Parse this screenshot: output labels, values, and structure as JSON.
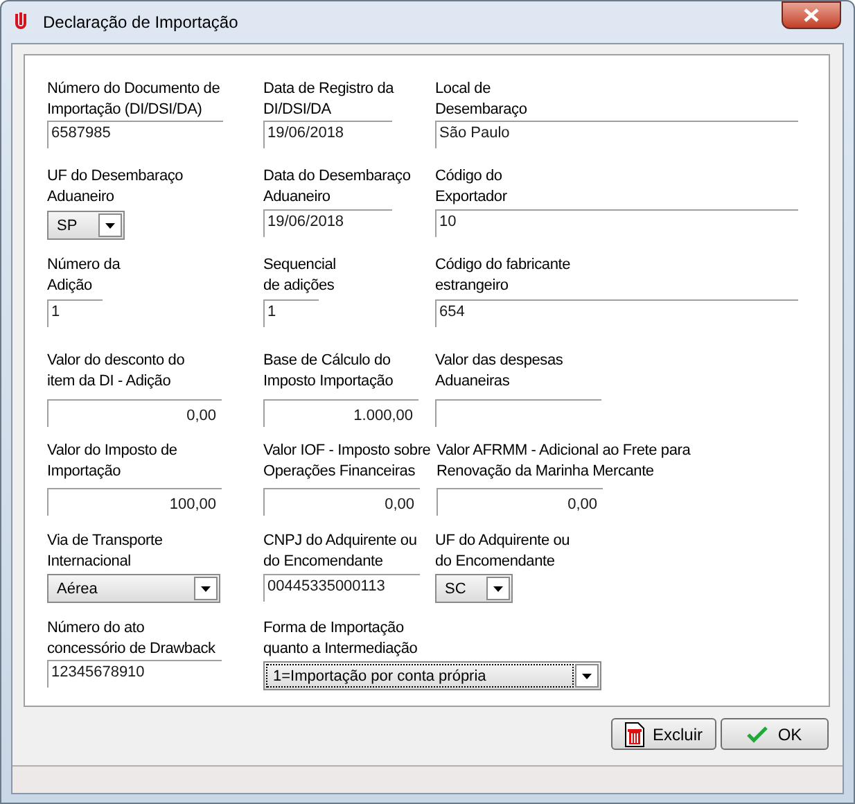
{
  "window": {
    "title": "Declaração de Importação"
  },
  "fields": [
    {
      "kind": "text",
      "label": "Número do Documento de\nImportação (DI/DSI/DA)",
      "value": "6587985"
    },
    {
      "kind": "text",
      "label": "Data de Registro da\nDI/DSI/DA",
      "value": "19/06/2018"
    },
    {
      "kind": "text",
      "label": "Local de\nDesembaraço",
      "value": "São Paulo"
    },
    {
      "kind": "combo",
      "label": "UF do Desembaraço\nAduaneiro",
      "value": "SP",
      "focused": false
    },
    {
      "kind": "text",
      "label": "Data do Desembaraço\nAduaneiro",
      "value": "19/06/2018"
    },
    {
      "kind": "text",
      "label": "Código do\nExportador",
      "value": "10"
    },
    {
      "kind": "text",
      "label": "Número da\nAdição",
      "value": "1"
    },
    {
      "kind": "text",
      "label": "Sequencial\nde adições",
      "value": "1"
    },
    {
      "kind": "text",
      "label": "Código do fabricante\nestrangeiro",
      "value": "654"
    },
    {
      "kind": "number",
      "label": "Valor do desconto do\nitem da DI - Adição",
      "value": "0,00"
    },
    {
      "kind": "number",
      "label": "Base de Cálculo do\nImposto Importação",
      "value": "1.000,00"
    },
    {
      "kind": "number",
      "label": "Valor das despesas\nAduaneiras"
    },
    {
      "kind": "number",
      "label": "Valor do Imposto de\nImportação",
      "value": "100,00"
    },
    {
      "kind": "number",
      "label": "Valor IOF - Imposto sobre\nOperações Financeiras",
      "value": "0,00"
    },
    {
      "kind": "number",
      "label": "Valor AFRMM - Adicional ao Frete para\nRenovação da Marinha Mercante",
      "value": "0,00"
    },
    {
      "kind": "combo",
      "label": "Via de Transporte\nInternacional",
      "value": "Aérea",
      "focused": false
    },
    {
      "kind": "text",
      "label": "CNPJ do Adquirente ou\ndo Encomendante",
      "value": "00445335000113"
    },
    {
      "kind": "combo",
      "label": "UF do Adquirente ou\ndo Encomendante",
      "value": "SC",
      "focused": false
    },
    {
      "kind": "text",
      "label": "Número do ato\nconcessório de Drawback",
      "value": "12345678910"
    },
    {
      "kind": "combo",
      "label": "Forma de Importação\nquanto a Intermediação",
      "value": "1=Importação por conta própria",
      "focused": true
    }
  ],
  "buttons": [
    {
      "kind": "delete",
      "label": "Excluir"
    },
    {
      "kind": "ok",
      "label": "OK"
    }
  ]
}
